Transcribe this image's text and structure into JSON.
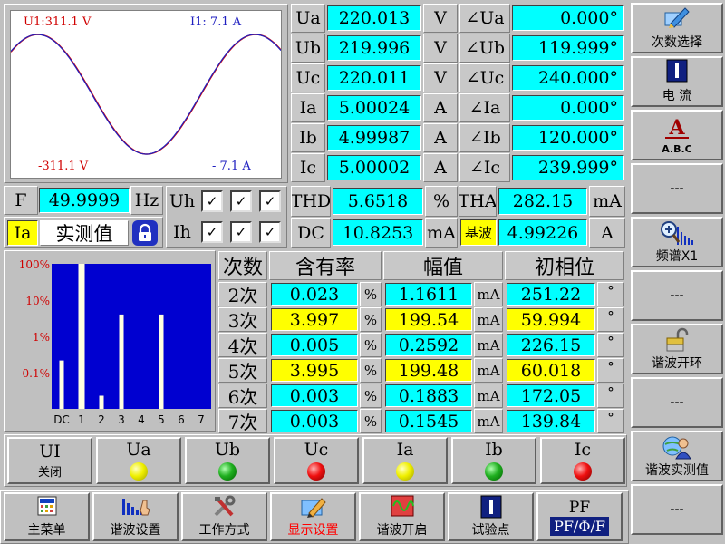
{
  "waveform": {
    "u_top": "U1:311.1 V",
    "i_top": "I1:  7.1 A",
    "u_bottom": "-311.1 V",
    "i_bottom": "- 7.1 A",
    "u_color": "#d00000",
    "i_color": "#2020c0"
  },
  "measurements": [
    {
      "label": "Ua",
      "value": "220.013",
      "unit": "V",
      "angle_label": "∠Ua",
      "angle": "0.000°"
    },
    {
      "label": "Ub",
      "value": "219.996",
      "unit": "V",
      "angle_label": "∠Ub",
      "angle": "119.999°"
    },
    {
      "label": "Uc",
      "value": "220.011",
      "unit": "V",
      "angle_label": "∠Uc",
      "angle": "240.000°"
    },
    {
      "label": "Ia",
      "value": "5.00024",
      "unit": "A",
      "angle_label": "∠Ia",
      "angle": "0.000°"
    },
    {
      "label": "Ib",
      "value": "4.99987",
      "unit": "A",
      "angle_label": "∠Ib",
      "angle": "120.000°"
    },
    {
      "label": "Ic",
      "value": "5.00002",
      "unit": "A",
      "angle_label": "∠Ic",
      "angle": "239.999°"
    }
  ],
  "frequency": {
    "label": "F",
    "value": "49.9999",
    "unit": "Hz"
  },
  "channel": {
    "name": "Ia",
    "mode": "实测值"
  },
  "harmonic_checks": [
    {
      "label": "Uh",
      "checks": [
        "✓",
        "✓",
        "✓"
      ]
    },
    {
      "label": "Ih",
      "checks": [
        "✓",
        "✓",
        "✓"
      ]
    }
  ],
  "summary": {
    "thd_label": "THD",
    "thd_value": "5.6518",
    "thd_unit": "%",
    "tha_label": "THA",
    "tha_value": "282.15",
    "tha_unit": "mA",
    "dc_label": "DC",
    "dc_value": "10.8253",
    "dc_unit": "mA",
    "fund_label": "基波",
    "fund_value": "4.99226",
    "fund_unit": "A"
  },
  "chart_data": {
    "type": "bar",
    "categories": [
      "DC",
      "1",
      "2",
      "3",
      "4",
      "5",
      "6",
      "7"
    ],
    "values": [
      0.2165,
      100,
      0.023,
      3.997,
      0.005,
      3.995,
      0.003,
      0.003
    ],
    "yscale": "log",
    "ylim": [
      0.01,
      100
    ],
    "ytick_labels": [
      "100%",
      "10%",
      "1%",
      "0.1%"
    ],
    "ytick_values": [
      100,
      10,
      1,
      0.1
    ],
    "bar_color": "#ffffe0",
    "background": "#0000d0",
    "grid": false
  },
  "harmonic_table": {
    "headers": [
      "次数",
      "含有率",
      "幅值",
      "初相位"
    ],
    "rows": [
      {
        "order": "2次",
        "ratio": "0.023",
        "ratio_unit": "%",
        "amp": "1.1611",
        "amp_unit": "mA",
        "phase": "251.22",
        "phase_unit": "°",
        "highlight": false
      },
      {
        "order": "3次",
        "ratio": "3.997",
        "ratio_unit": "%",
        "amp": "199.54",
        "amp_unit": "mA",
        "phase": "59.994",
        "phase_unit": "°",
        "highlight": true
      },
      {
        "order": "4次",
        "ratio": "0.005",
        "ratio_unit": "%",
        "amp": "0.2592",
        "amp_unit": "mA",
        "phase": "226.15",
        "phase_unit": "°",
        "highlight": false
      },
      {
        "order": "5次",
        "ratio": "3.995",
        "ratio_unit": "%",
        "amp": "199.48",
        "amp_unit": "mA",
        "phase": "60.018",
        "phase_unit": "°",
        "highlight": true
      },
      {
        "order": "6次",
        "ratio": "0.003",
        "ratio_unit": "%",
        "amp": "0.1883",
        "amp_unit": "mA",
        "phase": "172.05",
        "phase_unit": "°",
        "highlight": false
      },
      {
        "order": "7次",
        "ratio": "0.003",
        "ratio_unit": "%",
        "amp": "0.1545",
        "amp_unit": "mA",
        "phase": "139.84",
        "phase_unit": "°",
        "highlight": false
      }
    ]
  },
  "channel_buttons": [
    {
      "name": "ui",
      "label": "UI",
      "sub": "关闭",
      "led": ""
    },
    {
      "name": "ua",
      "label": "Ua",
      "sub": "",
      "led": "yellow"
    },
    {
      "name": "ub",
      "label": "Ub",
      "sub": "",
      "led": "green"
    },
    {
      "name": "uc",
      "label": "Uc",
      "sub": "",
      "led": "red"
    },
    {
      "name": "ia",
      "label": "Ia",
      "sub": "",
      "led": "yellow"
    },
    {
      "name": "ib",
      "label": "Ib",
      "sub": "",
      "led": "green"
    },
    {
      "name": "ic",
      "label": "Ic",
      "sub": "",
      "led": "red"
    }
  ],
  "bottom_menu": [
    {
      "name": "main-menu",
      "label": "主菜单",
      "icon": "calculator-icon",
      "active": false
    },
    {
      "name": "harmonic-settings",
      "label": "谐波设置",
      "icon": "spectrum-hand-icon",
      "active": false
    },
    {
      "name": "work-mode",
      "label": "工作方式",
      "icon": "tools-icon",
      "active": false
    },
    {
      "name": "display-settings",
      "label": "显示设置",
      "icon": "pen-display-icon",
      "active": true
    },
    {
      "name": "harmonic-on",
      "label": "谐波开启",
      "icon": "wave-icon",
      "active": false
    },
    {
      "name": "test-point",
      "label": "试验点",
      "icon": "marker-i-icon",
      "active": false
    },
    {
      "name": "pf-phase",
      "label": "PF/Φ/F",
      "top": "PF",
      "icon": "",
      "active": false
    }
  ],
  "side_menu": [
    {
      "name": "harmonic-order-select",
      "label": "次数选择",
      "icon": "pen-icon"
    },
    {
      "name": "current",
      "label": "电  流",
      "icon": "marker-i-icon"
    },
    {
      "name": "abc",
      "label": "A.B.C",
      "icon": "letter-a-icon"
    },
    {
      "name": "empty-1",
      "label": "---",
      "icon": ""
    },
    {
      "name": "spectrum-x1",
      "label": "频谱X1",
      "icon": "zoom-spectrum-icon"
    },
    {
      "name": "empty-2",
      "label": "---",
      "icon": ""
    },
    {
      "name": "harmonic-open-loop",
      "label": "谐波开环",
      "icon": "unlock-icon"
    },
    {
      "name": "empty-3",
      "label": "---",
      "icon": ""
    },
    {
      "name": "harmonic-measured",
      "label": "谐波实测值",
      "icon": "user-globe-icon"
    },
    {
      "name": "empty-4",
      "label": "---",
      "icon": ""
    }
  ],
  "colors": {
    "value_bg": "#00ffff",
    "highlight_bg": "#ffff00",
    "panel_bg": "#c0c0c0",
    "active_text": "#ff0000"
  }
}
